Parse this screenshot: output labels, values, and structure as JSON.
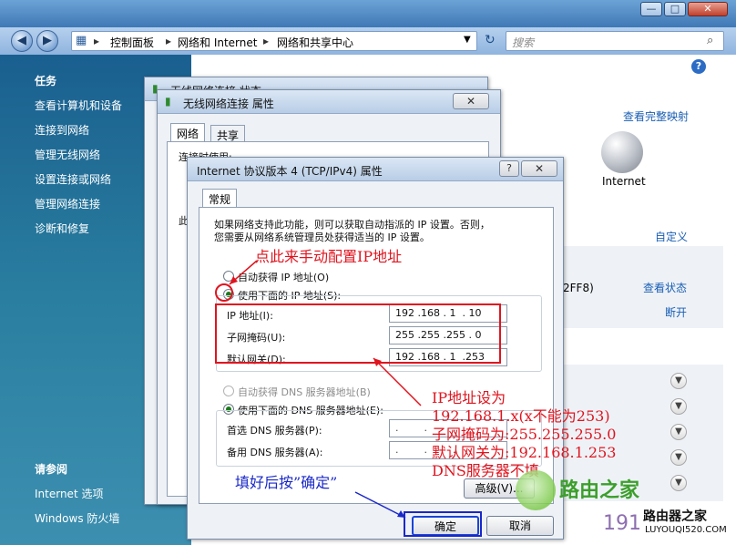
{
  "window": {
    "minimize": "—",
    "maximize": "□",
    "close": "✕"
  },
  "address": {
    "back_icon": "arrow-left-icon",
    "forward_icon": "arrow-right-icon",
    "path": [
      "控制面板",
      "网络和 Internet",
      "网络和共享中心"
    ],
    "search_placeholder": "搜索"
  },
  "sidebar": {
    "tasks_heading": "任务",
    "tasks": [
      "查看计算机和设备",
      "连接到网络",
      "管理无线网络",
      "设置连接或网络",
      "管理网络连接",
      "诊断和修复"
    ],
    "see_also_heading": "请参阅",
    "see_also": [
      "Internet 选项",
      "Windows 防火墙"
    ]
  },
  "content": {
    "full_map_link": "查看完整映射",
    "internet_label": "Internet",
    "customize_link": "自定义",
    "partial_text": "2FF8)",
    "view_status_link": "查看状态",
    "disconnect_link": "断开"
  },
  "status_dialog": {
    "title": "无线网络连接 状态"
  },
  "props_dialog": {
    "title": "无线网络连接 属性",
    "tabs": [
      "网络",
      "共享"
    ],
    "partial_label": "连接时使用:",
    "partial_label2": "此"
  },
  "tcpip_dialog": {
    "title": "Internet 协议版本 4 (TCP/IPv4) 属性",
    "help": "?",
    "tab": "常规",
    "description_line1": "如果网络支持此功能，则可以获取自动指派的 IP 设置。否则，",
    "description_line2": "您需要从网络系统管理员处获得适当的 IP 设置。",
    "auto_ip": "自动获得 IP 地址(O)",
    "manual_ip": "使用下面的 IP 地址(S):",
    "ip_label": "IP 地址(I):",
    "ip_value": "192 .168 . 1  . 10",
    "mask_label": "子网掩码(U):",
    "mask_value": "255 .255 .255 . 0",
    "gateway_label": "默认网关(D):",
    "gateway_value": "192 .168 . 1  .253",
    "auto_dns": "自动获得 DNS 服务器地址(B)",
    "manual_dns": "使用下面的 DNS 服务器地址(E):",
    "pref_dns_label": "首选 DNS 服务器(P):",
    "alt_dns_label": "备用 DNS 服务器(A):",
    "dns_dots": ".        .        .",
    "advanced_button": "高级(V)...",
    "ok_button": "确定",
    "cancel_button": "取消"
  },
  "annotations": {
    "click_hint": "点此来手动配置IP地址",
    "fill_hint": "填好后按”确定”",
    "settings_lines": [
      "IP地址设为",
      "192.168.1.x(x不能为253)",
      "子网掩码为:255.255.255.0",
      "默认网关为:192.168.1.253",
      "DNS服务器不填"
    ]
  },
  "watermark": {
    "brand": "路由之家",
    "brand2": "路由器之家",
    "domain": "LUYOUQI520.COM",
    "partial_num": "191"
  },
  "colors": {
    "annotation_red": "#e0141e",
    "annotation_blue": "#1a28c8",
    "link_blue": "#1a5fb4"
  }
}
